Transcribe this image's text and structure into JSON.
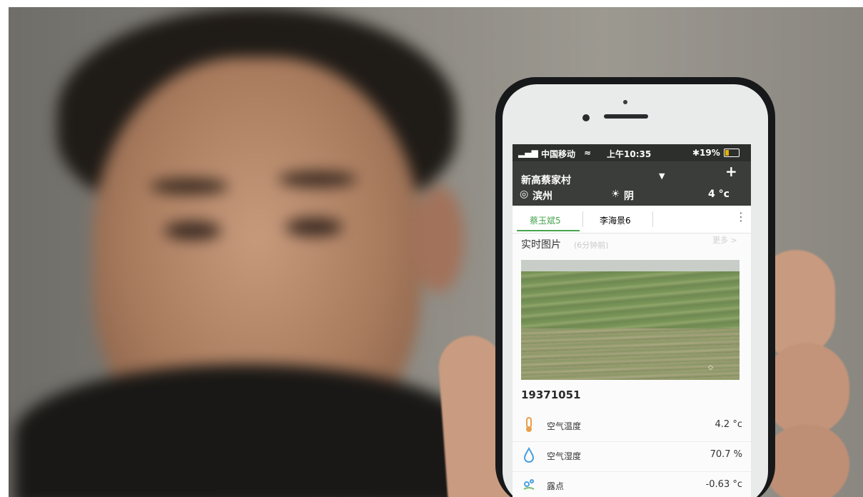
{
  "status_bar": {
    "carrier": "中国移动",
    "time": "上午10:35",
    "battery": "19%"
  },
  "app_bar": {
    "village": "新高蔡家村",
    "caret": "▼",
    "add": "+",
    "city": "滨州",
    "weather": "阴",
    "temperature": "4 °c"
  },
  "tabs": [
    {
      "label": "蔡玉斌5",
      "active": true
    },
    {
      "label": "李海景6",
      "active": false
    }
  ],
  "photo_section": {
    "title": "实时图片",
    "subtitle": "(6分钟前)",
    "more": "更多 >",
    "watermark": "AGRIO"
  },
  "device_id": "19371051",
  "readings": [
    {
      "icon": "thermometer-icon",
      "label": "空气温度",
      "value": "4.2 °c"
    },
    {
      "icon": "droplet-icon",
      "label": "空气湿度",
      "value": "70.7 %"
    },
    {
      "icon": "dew-icon",
      "label": "露点",
      "value": "-0.63 °c"
    }
  ],
  "colors": {
    "accent": "#47a44d",
    "app_bar": "#3a3d39",
    "status_bar": "#2d2f2c",
    "battery": "#e3b100"
  }
}
